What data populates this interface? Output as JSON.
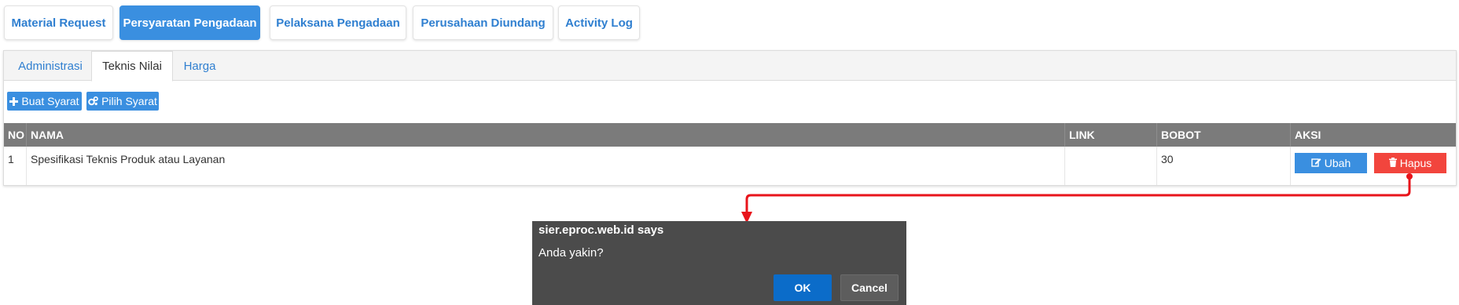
{
  "top_tabs": [
    {
      "label": "Material Request"
    },
    {
      "label": "Persyaratan Pengadaan"
    },
    {
      "label": "Pelaksana Pengadaan"
    },
    {
      "label": "Perusahaan Diundang"
    },
    {
      "label": "Activity Log"
    }
  ],
  "active_top_tab": "Persyaratan Pengadaan",
  "sub_tabs": [
    {
      "label": "Administrasi"
    },
    {
      "label": "Teknis Nilai"
    },
    {
      "label": "Harga"
    }
  ],
  "active_sub_tab": "Teknis Nilai",
  "actions": {
    "create_label": "Buat Syarat",
    "create_icon": "plus-icon",
    "choose_label": "Pilih Syarat",
    "choose_icon": "cogs-icon"
  },
  "table": {
    "headers": [
      "NO",
      "NAMA",
      "LINK",
      "BOBOT",
      "AKSI"
    ],
    "rows": [
      {
        "no": "1",
        "nama": "Spesifikasi Teknis Produk atau Layanan",
        "link": "",
        "bobot": "30",
        "edit_label": "Ubah",
        "delete_label": "Hapus"
      }
    ]
  },
  "dialog": {
    "title": "sier.eproc.web.id says",
    "message": "Anda yakin?",
    "ok_label": "OK",
    "cancel_label": "Cancel"
  },
  "colors": {
    "primary": "#3a8fe0",
    "danger": "#f2453d",
    "table_header": "#7b7b7b",
    "dialog_bg": "#4b4b4b",
    "dialog_ok": "#0b6cc9",
    "annotation": "#e8141b"
  }
}
